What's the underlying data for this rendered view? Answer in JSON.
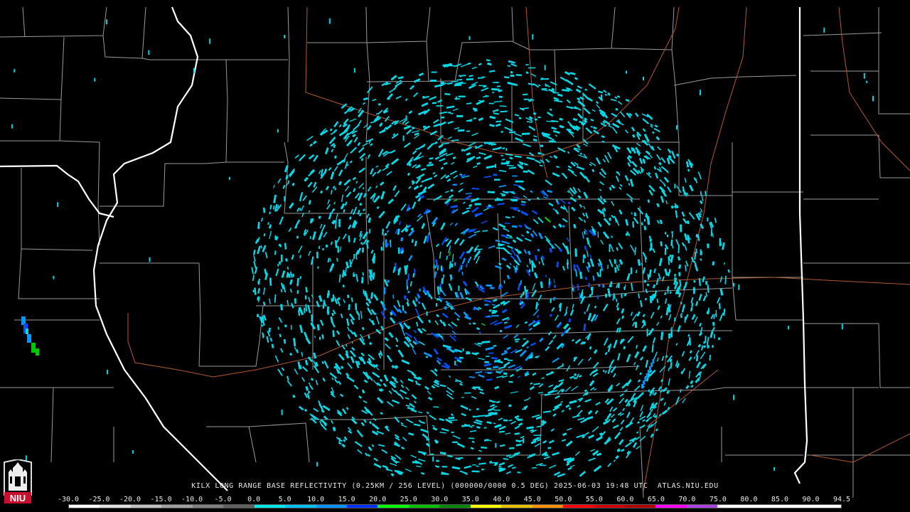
{
  "caption": {
    "station": "KILX",
    "product": "LONG RANGE BASE REFLECTIVITY",
    "resolution": "(0.25KM / 256 LEVEL)",
    "volume": "(000000/0000 0.5 DEG)",
    "date": "2025-06-03",
    "time": "19:48",
    "timezone": "UTC",
    "site": "ATLAS.NIU.EDU"
  },
  "scale": {
    "labels": [
      "-30.0",
      "-25.0",
      "-20.0",
      "-15.0",
      "-10.0",
      "-5.0",
      "0.0",
      "5.0",
      "10.0",
      "15.0",
      "20.0",
      "25.0",
      "30.0",
      "35.0",
      "40.0",
      "45.0",
      "50.0",
      "55.0",
      "60.0",
      "65.0",
      "70.0",
      "75.0",
      "80.0",
      "85.0",
      "90.0",
      "94.5"
    ],
    "colors": [
      "#ffffff",
      "#e0e0e0",
      "#c0c0c0",
      "#a0a0a0",
      "#808080",
      "#606060",
      "#00e8e8",
      "#00c0f0",
      "#0090ff",
      "#0030ff",
      "#00ff00",
      "#00c000",
      "#008800",
      "#ffff00",
      "#e8c000",
      "#ff9000",
      "#ff0000",
      "#d00000",
      "#b00000",
      "#ff00ff",
      "#b040e0",
      "#ffffff",
      "#ffffff",
      "#ffffff",
      "#ffffff"
    ]
  },
  "logo": {
    "text": "NIU",
    "color": "#c8102e"
  },
  "colors": {
    "background": "#000000",
    "county_lines": "#9a9a9a",
    "state_lines": "#ffffff",
    "highways": "#b05a30",
    "echo_light": "#00d8e8",
    "echo_medium": "#0098ff",
    "echo_strong": "#0050ff",
    "echo_green": "#00c800"
  }
}
